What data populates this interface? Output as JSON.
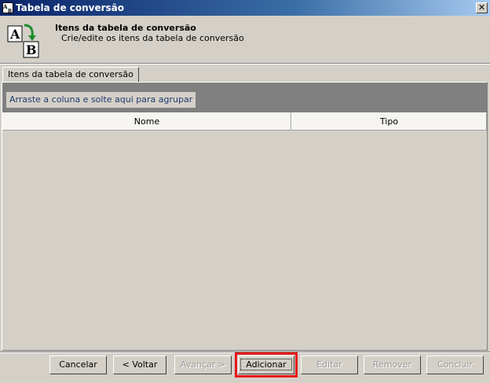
{
  "window": {
    "title": "Tabela de conversão",
    "close_label": "✕"
  },
  "header": {
    "title": "Itens da tabela de conversão",
    "subtitle": "Crie/edite os itens da tabela de conversão",
    "icon_letters": [
      "A",
      "B"
    ]
  },
  "tabs": [
    {
      "label": "Itens da tabela de conversão",
      "selected": true
    }
  ],
  "grid": {
    "group_hint": "Arraste a coluna e solte aqui para agrupar",
    "columns": [
      "Nome",
      "Tipo"
    ],
    "rows": []
  },
  "buttons": {
    "cancel": "Cancelar",
    "back": "< Voltar",
    "next": "Avançar >",
    "add": "Adicionar",
    "edit": "Editar",
    "remove": "Remover",
    "finish": "Concluir"
  },
  "colors": {
    "titlebar_start": "#0a246a",
    "titlebar_end": "#a6caf0",
    "focus_highlight": "#e8181a",
    "group_panel": "#808080",
    "window_bg": "#d4d0c8"
  }
}
